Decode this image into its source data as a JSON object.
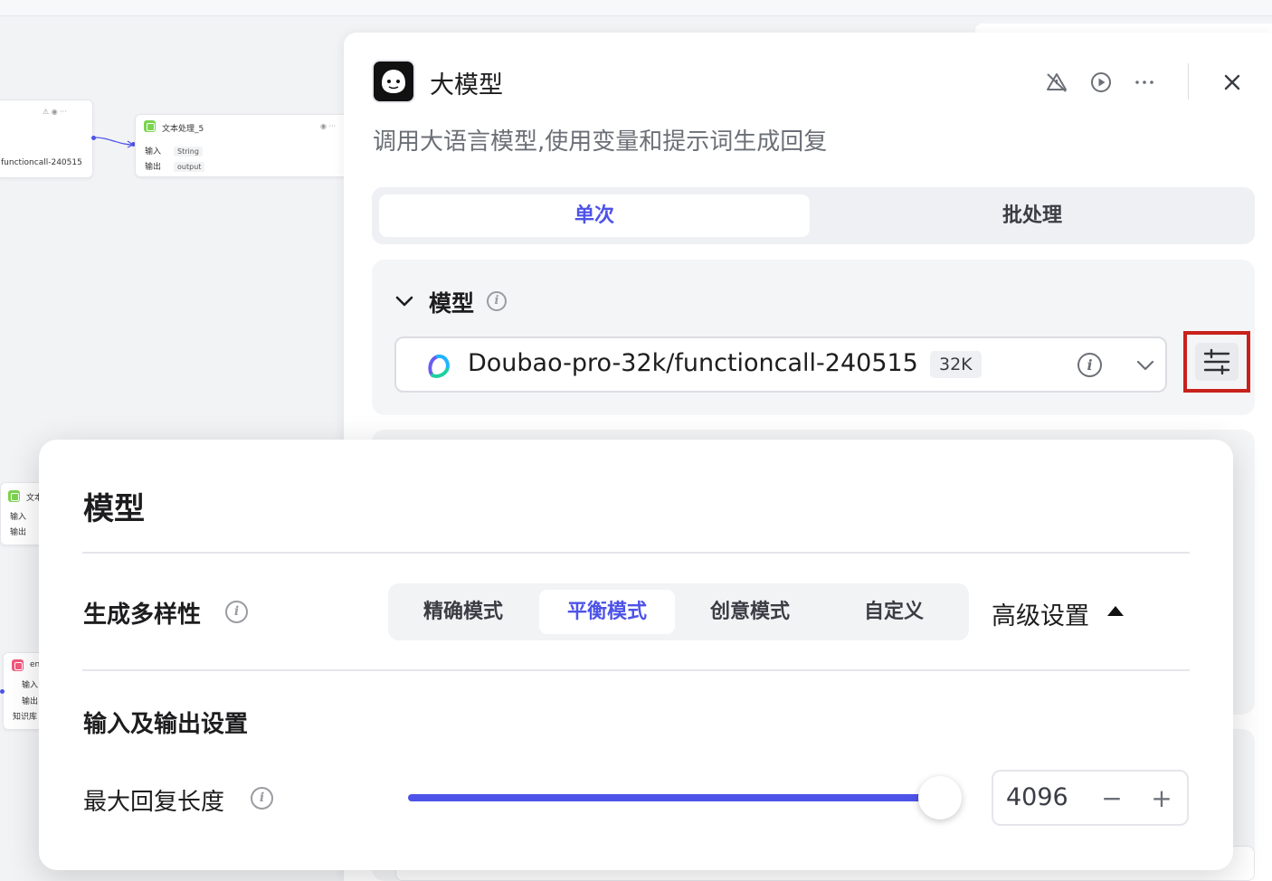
{
  "canvas": {
    "node1": {
      "model_text": "functioncall-240515"
    },
    "node2": {
      "title": "文本处理_5",
      "input_label": "输入",
      "output_label": "输出",
      "input_type": "String",
      "output_type": "output"
    },
    "node3": {
      "title": "文本",
      "input_label": "输入",
      "output_label": "输出"
    },
    "node4": {
      "title": "en",
      "input_label": "输入",
      "output_label": "输出",
      "kb_label": "知识库"
    }
  },
  "panel": {
    "title": "大模型",
    "subtitle": "调用大语言模型,使用变量和提示词生成回复",
    "tabs": [
      {
        "label": "单次",
        "active": true
      },
      {
        "label": "批处理",
        "active": false
      }
    ],
    "model_section": {
      "label": "模型",
      "selected_model": "Doubao-pro-32k/functioncall-240515",
      "context_tag": "32K"
    }
  },
  "popover": {
    "title": "模型",
    "diversity_label": "生成多样性",
    "modes": [
      {
        "label": "精确模式",
        "active": false
      },
      {
        "label": "平衡模式",
        "active": true
      },
      {
        "label": "创意模式",
        "active": false
      },
      {
        "label": "自定义",
        "active": false
      }
    ],
    "advanced_label": "高级设置",
    "io_section_label": "输入及输出设置",
    "max_length_label": "最大回复长度",
    "max_length_value": "4096",
    "max_length_fraction": 1.0
  },
  "colors": {
    "accent": "#4d53e8",
    "highlight_border": "#c8221c"
  },
  "icons": [
    "bug-off-icon",
    "play-icon",
    "more-icon",
    "close-icon",
    "chevron-down-icon",
    "info-icon",
    "settings-sliders-icon",
    "doubao-logo-icon",
    "caret-up-icon",
    "minus-icon",
    "plus-icon"
  ]
}
